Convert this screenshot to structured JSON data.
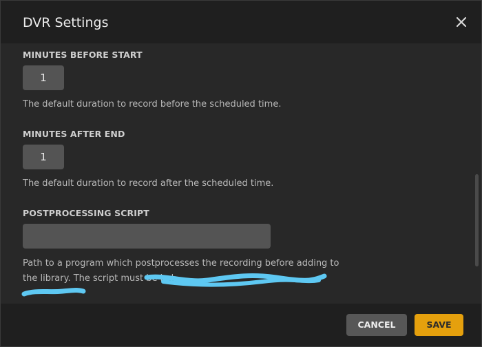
{
  "dialog": {
    "title": "DVR Settings"
  },
  "settings": [
    {
      "label": "MINUTES BEFORE START",
      "value": "1",
      "description": "The default duration to record before the scheduled time."
    },
    {
      "label": "MINUTES AFTER END",
      "value": "1",
      "description": "The default duration to record after the scheduled time."
    },
    {
      "label": "POSTPROCESSING SCRIPT",
      "value": "",
      "description": "Path to a program which postprocesses the recording before adding to the library. The script must be in '"
    }
  ],
  "footer": {
    "cancel_label": "CANCEL",
    "save_label": "SAVE"
  },
  "colors": {
    "accent": "#e5a00d",
    "redaction": "#5ec8f2"
  },
  "icons": {
    "close": "close-icon"
  }
}
